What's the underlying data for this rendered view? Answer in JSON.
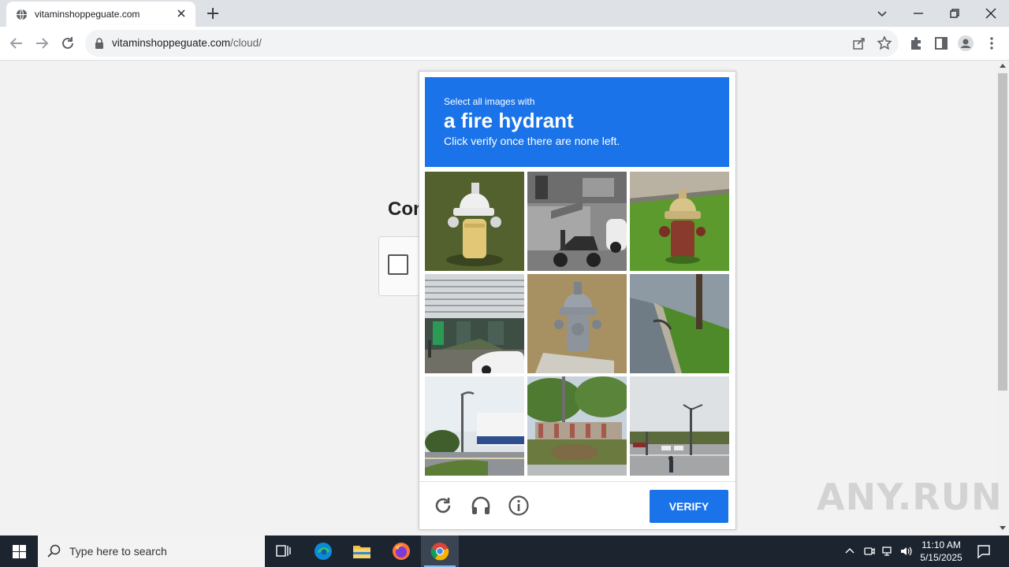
{
  "browser": {
    "tab_title": "vitaminshoppeguate.com",
    "url_domain": "vitaminshoppeguate.com",
    "url_path": "/cloud/"
  },
  "page": {
    "heading_partial": "Con"
  },
  "captcha": {
    "instruction_line1": "Select all images with",
    "instruction_target": "a fire hydrant",
    "instruction_line3": "Click verify once there are none left.",
    "tiles": [
      {
        "subject": "yellow-fire-hydrant"
      },
      {
        "subject": "scooter-by-stairs"
      },
      {
        "subject": "red-fire-hydrant"
      },
      {
        "subject": "building-with-car"
      },
      {
        "subject": "grey-fire-hydrant"
      },
      {
        "subject": "curb-with-grass"
      },
      {
        "subject": "street-lamp-building"
      },
      {
        "subject": "fence-with-trees"
      },
      {
        "subject": "intersection-with-pedestrian"
      }
    ],
    "verify_label": "VERIFY",
    "accent_color": "#1a73e8"
  },
  "watermark": "ANY.RUN",
  "taskbar": {
    "search_placeholder": "Type here to search",
    "time": "11:10 AM",
    "date": "5/15/2025"
  }
}
